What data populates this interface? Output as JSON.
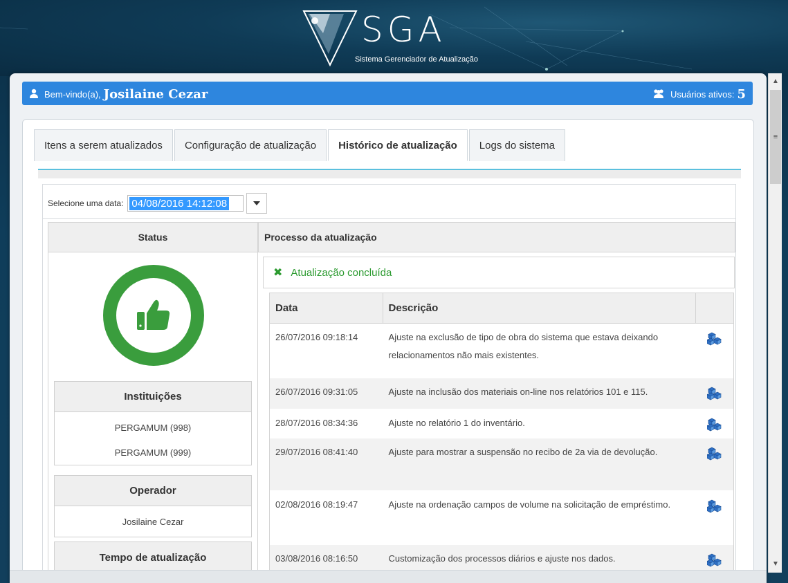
{
  "brand": {
    "logo_text": "SGA",
    "logo_subtitle": "Sistema Gerenciador de Atualização"
  },
  "welcome": {
    "greeting": "Bem-vindo(a),",
    "user_name": "Josilaine Cezar",
    "active_users_label": "Usuários ativos:",
    "active_users_count": "5"
  },
  "tabs": [
    {
      "label": "Itens a serem atualizados",
      "active": false
    },
    {
      "label": "Configuração de atualização",
      "active": false
    },
    {
      "label": "Histórico de atualização",
      "active": true
    },
    {
      "label": "Logs do sistema",
      "active": false
    }
  ],
  "date_selector": {
    "label": "Selecione uma data:",
    "value": "04/08/2016 14:12:08"
  },
  "status": {
    "header": "Status",
    "institutions_title": "Instituições",
    "institutions": [
      "PERGAMUM (998)",
      "PERGAMUM (999)"
    ],
    "operator_title": "Operador",
    "operator": "Josilaine Cezar",
    "time_title": "Tempo de atualização"
  },
  "process": {
    "header": "Processo da atualização",
    "status_text": "Atualização concluída",
    "table_headers": {
      "date": "Data",
      "description": "Descrição"
    },
    "rows": [
      {
        "date": "26/07/2016 09:18:14",
        "description": "Ajuste na exclusão de tipo de obra do sistema que estava deixando relacionamentos não mais existentes."
      },
      {
        "date": "26/07/2016 09:31:05",
        "description": "Ajuste na inclusão dos materiais on-line nos relatórios 101 e 115."
      },
      {
        "date": "28/07/2016 08:34:36",
        "description": "Ajuste no relatório 1 do inventário."
      },
      {
        "date": "29/07/2016 08:41:40",
        "description": "Ajuste para mostrar a suspensão no recibo de 2a via de devolução."
      },
      {
        "date": "02/08/2016 08:19:47",
        "description": "Ajuste na ordenação campos de volume na solicitação de empréstimo."
      },
      {
        "date": "03/08/2016 08:16:50",
        "description": "Customização dos processos diários e ajuste nos dados."
      }
    ]
  },
  "colors": {
    "welcome_bar": "#2e86de",
    "success_green": "#3a9d3d",
    "tab_accent": "#5bc0de"
  }
}
